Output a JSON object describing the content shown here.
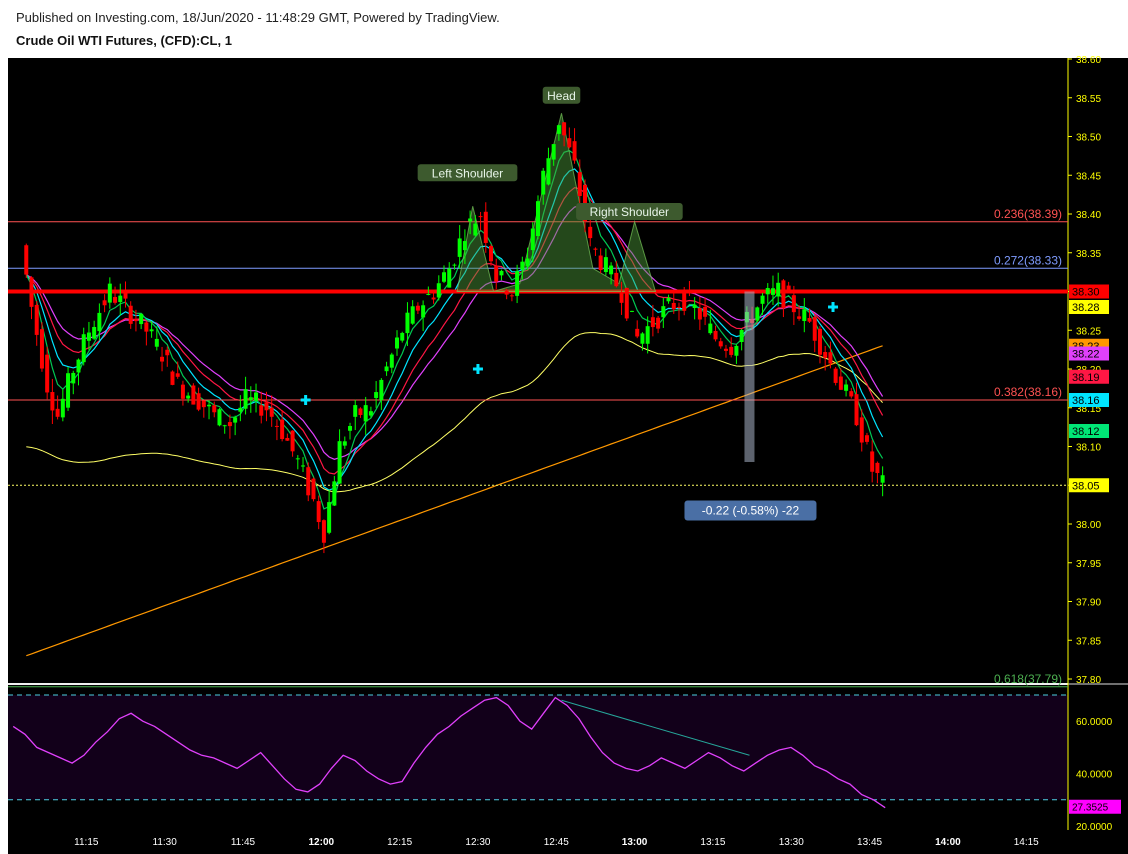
{
  "header": {
    "published": "Published on Investing.com, 18/Jun/2020 - 11:48:29 GMT, Powered by TradingView.",
    "symbol": "Crude Oil WTI Futures, (CFD):CL, 1"
  },
  "colors": {
    "background": "#000000",
    "up": "#00ff00",
    "down": "#ff0000",
    "axis_text": "#ffff00",
    "rsi_line": "#e040fb",
    "ema_cyan": "#00e5ff",
    "ema_green": "#00c853",
    "ema_red": "#ff1744",
    "ema_magenta": "#e040fb",
    "sma_yellow": "#ffff66",
    "sma_orange": "#ff9800"
  },
  "chart_data": [
    {
      "type": "candlestick",
      "title": "Crude Oil WTI Futures, (CFD):CL, 1",
      "ylim": [
        37.8,
        38.6
      ],
      "y_ticks": [
        38.6,
        38.55,
        38.5,
        38.45,
        38.4,
        38.35,
        38.3,
        38.25,
        38.2,
        38.15,
        38.1,
        38.05,
        38.0,
        37.95,
        37.9,
        37.85,
        37.8
      ],
      "x_tick_labels": [
        "11:15",
        "11:30",
        "11:45",
        "12:00",
        "12:15",
        "12:30",
        "12:45",
        "13:00",
        "13:15",
        "13:30",
        "13:45",
        "14:00",
        "14:15"
      ],
      "price_path": [
        [
          "11:03",
          38.36
        ],
        [
          "11:05",
          38.28
        ],
        [
          "11:08",
          38.18
        ],
        [
          "11:10",
          38.14
        ],
        [
          "11:13",
          38.2
        ],
        [
          "11:16",
          38.25
        ],
        [
          "11:20",
          38.3
        ],
        [
          "11:23",
          38.28
        ],
        [
          "11:27",
          38.25
        ],
        [
          "11:30",
          38.22
        ],
        [
          "11:33",
          38.18
        ],
        [
          "11:37",
          38.16
        ],
        [
          "11:40",
          38.14
        ],
        [
          "11:43",
          38.13
        ],
        [
          "11:46",
          38.16
        ],
        [
          "11:50",
          38.15
        ],
        [
          "11:53",
          38.12
        ],
        [
          "11:56",
          38.08
        ],
        [
          "11:59",
          38.03
        ],
        [
          "12:01",
          37.99
        ],
        [
          "12:04",
          38.1
        ],
        [
          "12:07",
          38.14
        ],
        [
          "12:10",
          38.15
        ],
        [
          "12:13",
          38.2
        ],
        [
          "12:16",
          38.25
        ],
        [
          "12:19",
          38.28
        ],
        [
          "12:22",
          38.3
        ],
        [
          "12:25",
          38.33
        ],
        [
          "12:28",
          38.38
        ],
        [
          "12:31",
          38.4
        ],
        [
          "12:34",
          38.32
        ],
        [
          "12:37",
          38.3
        ],
        [
          "12:40",
          38.35
        ],
        [
          "12:43",
          38.45
        ],
        [
          "12:46",
          38.52
        ],
        [
          "12:49",
          38.46
        ],
        [
          "12:52",
          38.36
        ],
        [
          "12:55",
          38.33
        ],
        [
          "12:58",
          38.3
        ],
        [
          "13:01",
          38.24
        ],
        [
          "13:04",
          38.26
        ],
        [
          "13:07",
          38.28
        ],
        [
          "13:10",
          38.29
        ],
        [
          "13:13",
          38.27
        ],
        [
          "13:16",
          38.24
        ],
        [
          "13:19",
          38.23
        ],
        [
          "13:22",
          38.26
        ],
        [
          "13:25",
          38.29
        ],
        [
          "13:28",
          38.3
        ],
        [
          "13:31",
          38.28
        ],
        [
          "13:34",
          38.26
        ],
        [
          "13:37",
          38.22
        ],
        [
          "13:40",
          38.18
        ],
        [
          "13:43",
          38.14
        ],
        [
          "13:46",
          38.07
        ],
        [
          "13:48",
          38.05
        ]
      ],
      "overlay_lines": [
        {
          "level": 38.39,
          "label": "0.236(38.39)",
          "color": "#ff5252"
        },
        {
          "level": 38.33,
          "label": "0.272(38.33)",
          "color": "#7f9cff"
        },
        {
          "level": 38.16,
          "label": "0.382(38.16)",
          "color": "#ff5252"
        },
        {
          "level": 37.79,
          "label": "0.618(37.79)",
          "color": "#4caf50"
        }
      ],
      "support_line": 38.3,
      "last_price_line": 38.05,
      "price_badges": [
        {
          "value": "38.30",
          "color": "#ff0000",
          "text_color": "#000000"
        },
        {
          "value": "38.28",
          "color": "#ffff00",
          "text_color": "#000000"
        },
        {
          "value": "38.23",
          "color": "#ff9800",
          "text_color": "#000000"
        },
        {
          "value": "38.22",
          "color": "#e040fb",
          "text_color": "#000000"
        },
        {
          "value": "38.19",
          "color": "#ff1744",
          "text_color": "#000000"
        },
        {
          "value": "38.16",
          "color": "#00e5ff",
          "text_color": "#000000"
        },
        {
          "value": "38.12",
          "color": "#00e676",
          "text_color": "#000000"
        },
        {
          "value": "38.05",
          "color": "#ffff00",
          "text_color": "#000000"
        }
      ],
      "annotations": [
        {
          "text": "Left Shoulder",
          "time": "12:28",
          "price": 38.45
        },
        {
          "text": "Head",
          "time": "12:46",
          "price": 38.55
        },
        {
          "text": "Right Shoulder",
          "time": "12:59",
          "price": 38.4
        }
      ],
      "measure_box": {
        "text": "-0.22 (-0.58%) -22",
        "time": "13:22",
        "price": 38.02
      }
    },
    {
      "type": "line",
      "title": "",
      "ylim": [
        20,
        70
      ],
      "y_ticks": [
        "60.0000",
        "40.0000",
        "20.0000"
      ],
      "upper_band": 70,
      "lower_band": 30,
      "last_value_badge": "27.3525",
      "values": [
        58,
        55,
        50,
        48,
        46,
        44,
        47,
        52,
        56,
        61,
        63,
        60,
        58,
        55,
        52,
        49,
        47,
        46,
        44,
        42,
        45,
        48,
        43,
        38,
        34,
        33,
        36,
        42,
        47,
        45,
        41,
        38,
        36,
        37,
        44,
        50,
        55,
        58,
        62,
        65,
        68,
        69,
        66,
        60,
        57,
        63,
        69,
        66,
        61,
        54,
        48,
        44,
        42,
        41,
        43,
        46,
        44,
        42,
        45,
        48,
        46,
        43,
        41,
        44,
        47,
        49,
        50,
        47,
        43,
        41,
        38,
        36,
        32,
        30,
        27
      ]
    }
  ]
}
